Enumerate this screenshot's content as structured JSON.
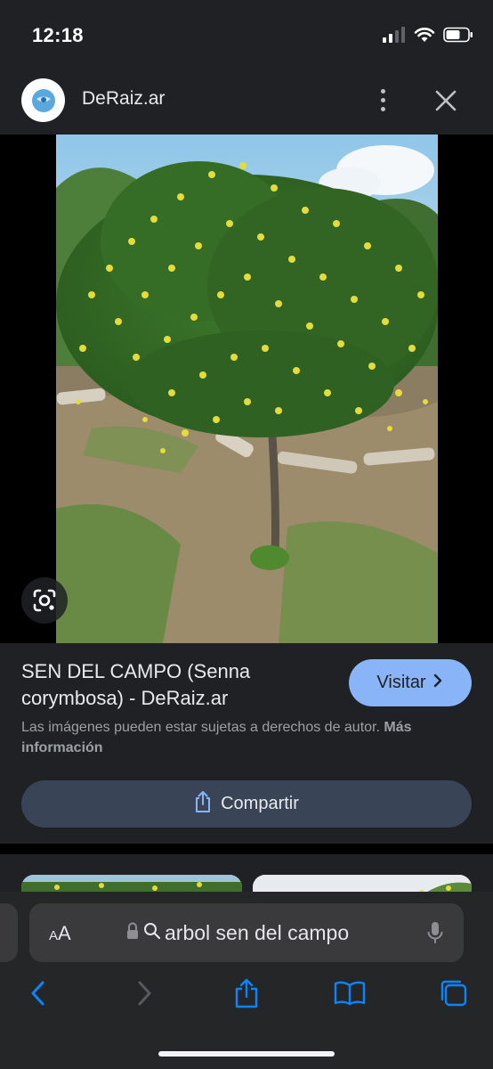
{
  "status_bar": {
    "time": "12:18"
  },
  "header": {
    "site_name": "DeRaiz.ar"
  },
  "image": {
    "alt": "Árbol de sen del campo con flores amarillas"
  },
  "result": {
    "title": "SEN DEL CAMPO (Senna corymbosa) - DeRaiz.ar",
    "visit_label": "Visitar",
    "copyright_text": "Las imágenes pueden estar sujetas a derechos de autor.",
    "more_info_label": "Más información",
    "share_label": "Compartir"
  },
  "safari": {
    "aa_label_small": "A",
    "aa_label_large": "A",
    "url_text": "arbol sen del campo"
  },
  "colors": {
    "panel_bg": "#202124",
    "accent": "#8ab4f8",
    "share_bg": "#394457",
    "ios_blue": "#0a84ff"
  },
  "icons": {
    "cellular": "cellular-signal-icon",
    "wifi": "wifi-icon",
    "battery": "battery-icon",
    "more": "more-vertical-icon",
    "close": "close-icon",
    "lens": "google-lens-icon",
    "chevron": "chevron-right-icon",
    "share": "share-icon",
    "lock": "lock-icon",
    "search": "search-icon",
    "mic": "microphone-icon",
    "back": "back-arrow-icon",
    "forward": "forward-arrow-icon",
    "bookmarks": "bookmarks-icon",
    "tabs": "tabs-icon"
  }
}
